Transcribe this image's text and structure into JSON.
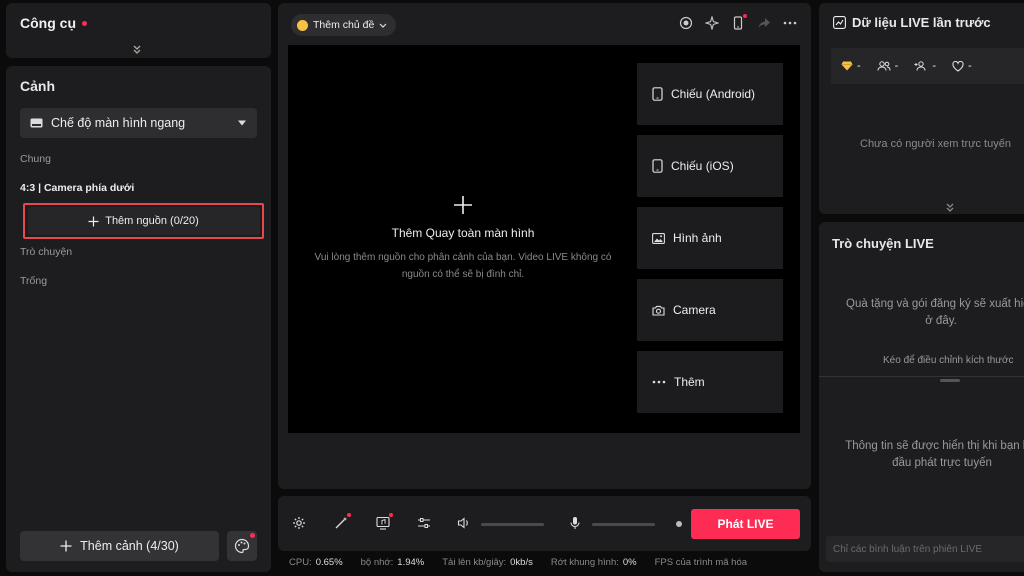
{
  "tools": {
    "title": "Công cụ"
  },
  "scene": {
    "title": "Cảnh",
    "mode": "Chế độ màn hình ngang",
    "sections": {
      "general": "Chung",
      "chat": "Trò chuyện",
      "empty": "Trống"
    },
    "scene_name": "4:3 | Camera phía dưới",
    "add_source": "Thêm nguồn (0/20)",
    "add_scene": "Thêm cảnh (4/30)"
  },
  "center": {
    "topic": "Thêm chủ đề",
    "preview": {
      "title": "Thêm Quay toàn màn hình",
      "subtitle": "Vui lòng thêm nguồn cho phân cảnh của bạn. Video LIVE không có nguồn có thể sẽ bị đình chỉ."
    },
    "sources": [
      {
        "label": "Chiếu (Android)",
        "icon": "phone-icon"
      },
      {
        "label": "Chiếu (iOS)",
        "icon": "phone-icon"
      },
      {
        "label": "Hình ảnh",
        "icon": "image-icon"
      },
      {
        "label": "Camera",
        "icon": "camera-icon"
      },
      {
        "label": "Thêm",
        "icon": "more-icon"
      }
    ]
  },
  "controls": {
    "go_live": "Phát LIVE"
  },
  "status": {
    "cpu_label": "CPU:",
    "cpu": "0.65%",
    "memory_label": "bộ nhớ:",
    "memory": "1.94%",
    "upload_label": "Tải lên kb/giây:",
    "upload": "0kb/s",
    "dropped_label": "Rớt khung hình:",
    "dropped": "0%",
    "fps_label": "FPS của trình mã hóa"
  },
  "data": {
    "title": "Dữ liệu LIVE lần trước",
    "stats": [
      "-",
      "-",
      "-",
      "-"
    ],
    "empty": "Chưa có người xem trực tuyến"
  },
  "chat": {
    "title": "Trò chuyện LIVE",
    "gift_msg": "Quà tặng và gói đăng ký sẽ xuất hiện ở đây.",
    "drag_hint": "Kéo để điều chỉnh kích thước",
    "info_msg": "Thông tin sẽ được hiển thị khi bạn bắt đầu phát trực tuyến",
    "comment_placeholder": "Chỉ các bình luận trên phiên LIVE"
  },
  "colors": {
    "accent": "#fe2c55",
    "highlight": "#e5484d",
    "panel": "#1d1d1f",
    "background": "#0b0b0b"
  }
}
